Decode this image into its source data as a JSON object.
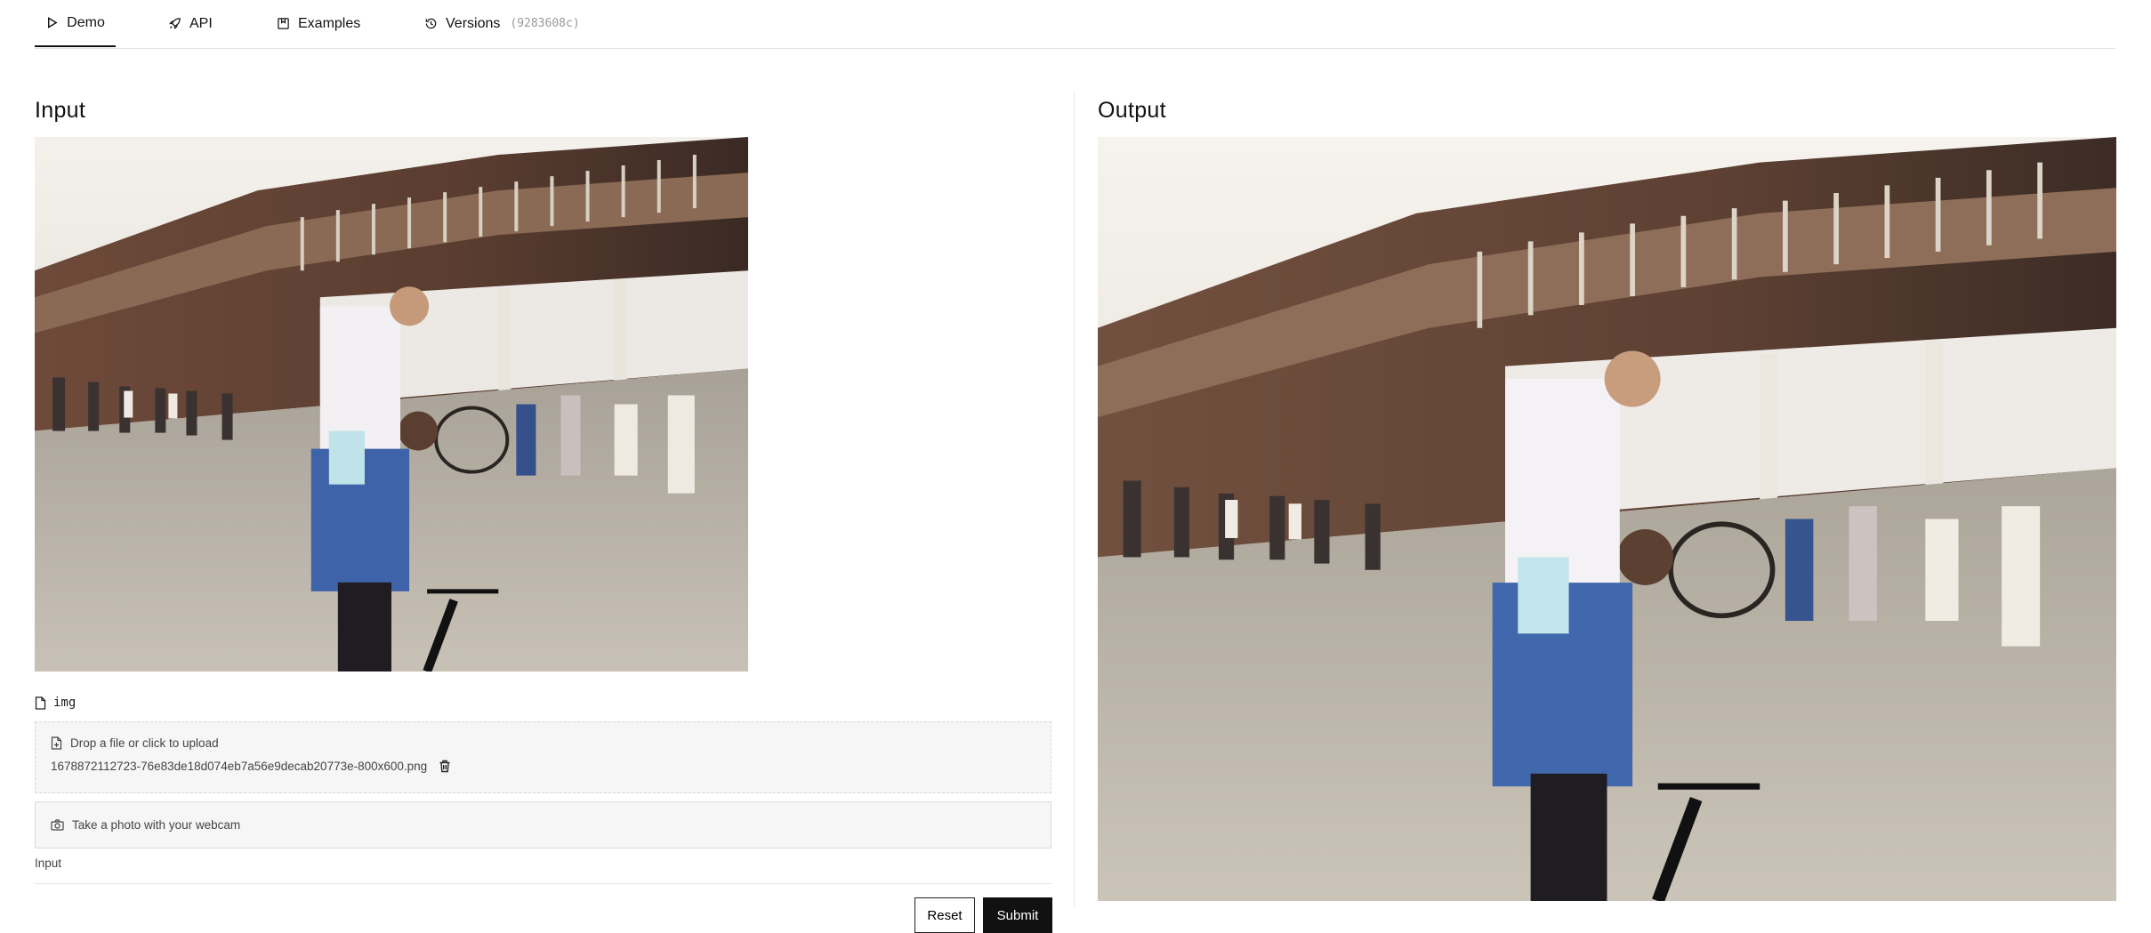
{
  "tabs": [
    {
      "label": "Demo",
      "icon": "play-icon",
      "active": true
    },
    {
      "label": "API",
      "icon": "rocket-icon"
    },
    {
      "label": "Examples",
      "icon": "bookmark-image-icon"
    },
    {
      "label": "Versions",
      "icon": "history-icon",
      "hash": "(9283608c)"
    }
  ],
  "input": {
    "title": "Input",
    "field_name": "img",
    "upload_prompt": "Drop a file or click to upload",
    "filename": "1678872112723-76e83de18d074eb7a56e9decab20773e-800x600.png",
    "webcam_label": "Take a photo with your webcam",
    "hint": "Input",
    "reset_label": "Reset",
    "submit_label": "Submit"
  },
  "output": {
    "title": "Output"
  },
  "colors": {
    "accent": "#111111",
    "border": "#e3e3e3",
    "muted_bg": "#f6f6f6"
  }
}
